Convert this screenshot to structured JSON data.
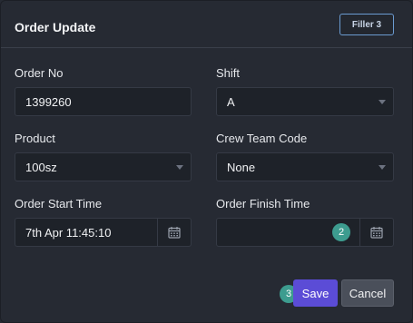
{
  "header": {
    "title": "Order Update",
    "filler_badge": "Filler 3"
  },
  "form": {
    "order_no": {
      "label": "Order No",
      "value": "1399260"
    },
    "shift": {
      "label": "Shift",
      "value": "A"
    },
    "product": {
      "label": "Product",
      "value": "100sz"
    },
    "crew_team_code": {
      "label": "Crew Team Code",
      "value": "None"
    },
    "order_start_time": {
      "label": "Order Start Time",
      "value": "7th Apr 11:45:10"
    },
    "order_finish_time": {
      "label": "Order Finish Time",
      "value": ""
    }
  },
  "step_badges": {
    "finish_time": "2",
    "save": "3"
  },
  "actions": {
    "save_label": "Save",
    "cancel_label": "Cancel"
  },
  "colors": {
    "accent": "#5b4cd6",
    "step_badge": "#3d9c8f",
    "background": "#262a33"
  },
  "icons": {
    "calendar": "calendar-icon",
    "dropdown": "chevron-down-icon"
  }
}
